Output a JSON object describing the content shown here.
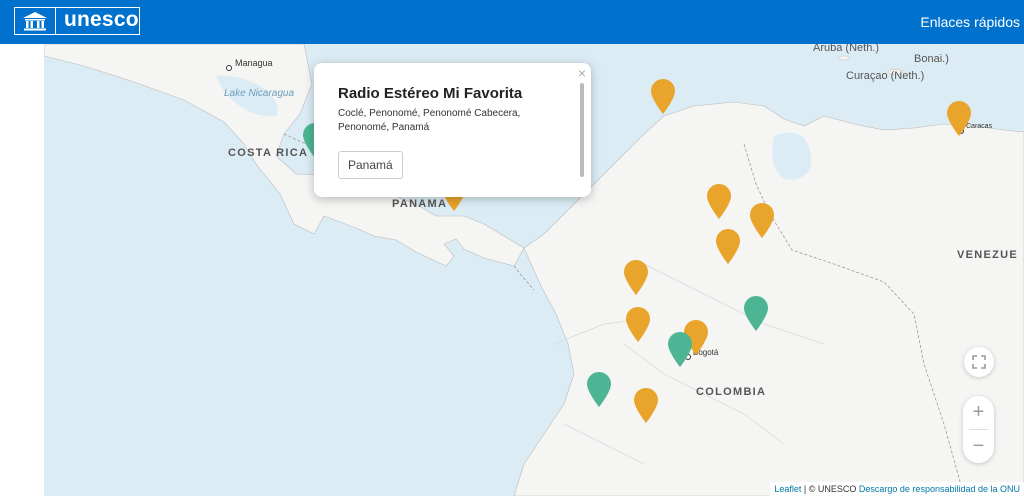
{
  "header": {
    "logo_text": "unesco",
    "quick_links": "Enlaces rápidos"
  },
  "map": {
    "labels": {
      "managua": "Managua",
      "lake_nicaragua": "Lake Nicaragua",
      "costa_rica": "COSTA RICA",
      "panama": "PANAMA",
      "colombia": "COLOMBIA",
      "venezuela": "VENEZUE",
      "aruba": "Aruba (Neth.)",
      "bonaire": "Bonai.)",
      "curacao": "Curaçao (Neth.)",
      "caracas": "Caracas",
      "bogota": "Bogotá"
    },
    "markers": [
      {
        "id": "m1",
        "color": "orange"
      },
      {
        "id": "m2",
        "color": "orange"
      },
      {
        "id": "m3",
        "color": "green"
      },
      {
        "id": "m4",
        "color": "orange"
      },
      {
        "id": "m5",
        "color": "orange"
      },
      {
        "id": "m6",
        "color": "orange"
      },
      {
        "id": "m7",
        "color": "orange"
      },
      {
        "id": "m8",
        "color": "orange"
      },
      {
        "id": "m9",
        "color": "orange"
      },
      {
        "id": "m10",
        "color": "green"
      },
      {
        "id": "m11",
        "color": "orange"
      },
      {
        "id": "m12",
        "color": "green"
      },
      {
        "id": "m13",
        "color": "green"
      },
      {
        "id": "m14",
        "color": "orange"
      },
      {
        "id": "m15",
        "color": "orange"
      }
    ],
    "marker_colors": {
      "orange": "#e8a42b",
      "green": "#4db593"
    }
  },
  "popup": {
    "title": "Radio Estéreo Mi Favorita",
    "address": "Coclé, Penonomé, Penonomé Cabecera, Penonomé, Panamá",
    "tag": "Panamá",
    "close_symbol": "×"
  },
  "controls": {
    "fullscreen_icon": "fullscreen-icon",
    "zoom_in": "+",
    "zoom_out": "−"
  },
  "attribution": {
    "leaflet": "Leaflet",
    "separator": " | © UNESCO ",
    "disclaimer": "Descargo de responsabilidad de la ONU"
  }
}
